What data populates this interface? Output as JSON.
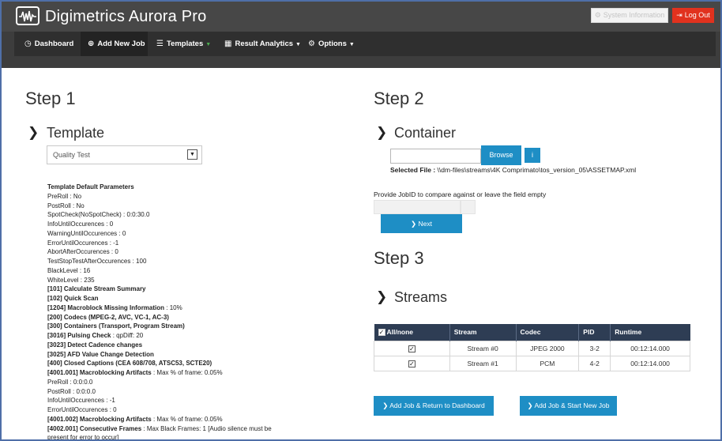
{
  "app": {
    "brand": "Digimetrics Aurora Pro",
    "system_info_label": "System Information",
    "logout_label": "Log Out"
  },
  "nav": {
    "dashboard": "Dashboard",
    "add_new_job": "Add New Job",
    "templates": "Templates",
    "result_analytics": "Result Analytics",
    "options": "Options"
  },
  "step1": {
    "title": "Step 1",
    "section": "Template",
    "selected_template": "Quality Test",
    "params_title": "Template Default Parameters",
    "params": [
      {
        "bold": "",
        "text": "PreRoll : No"
      },
      {
        "bold": "",
        "text": "PostRoll : No"
      },
      {
        "bold": "",
        "text": "SpotCheck(NoSpotCheck) : 0:0:30.0"
      },
      {
        "bold": "",
        "text": "InfoUntilOccurences : 0"
      },
      {
        "bold": "",
        "text": "WarningUntilOccurences : 0"
      },
      {
        "bold": "",
        "text": "ErrorUntilOccurences : -1"
      },
      {
        "bold": "",
        "text": "AbortAfterOccurences : 0"
      },
      {
        "bold": "",
        "text": "TestStopTestAfterOccurences : 100"
      },
      {
        "bold": "",
        "text": "BlackLevel : 16"
      },
      {
        "bold": "",
        "text": "WhiteLevel : 235"
      },
      {
        "bold": "[101] Calculate Stream Summary",
        "text": ""
      },
      {
        "bold": "[102] Quick Scan",
        "text": ""
      },
      {
        "bold": "[1204] Macroblock Missing Information",
        "text": " : 10%"
      },
      {
        "bold": "[200] Codecs (MPEG-2, AVC, VC-1, AC-3)",
        "text": ""
      },
      {
        "bold": "[300] Containers (Transport, Program Stream)",
        "text": ""
      },
      {
        "bold": "[3016] Pulsing Check",
        "text": " : qpDiff: 20"
      },
      {
        "bold": "[3023] Detect Cadence changes",
        "text": ""
      },
      {
        "bold": "[3025] AFD Value Change Detection",
        "text": ""
      },
      {
        "bold": "[400] Closed Captions (CEA 608/708, ATSC53, SCTE20)",
        "text": ""
      },
      {
        "bold": "[4001.001] Macroblocking Artifacts",
        "text": " : Max % of frame: 0.05%"
      },
      {
        "bold": "",
        "text": "PreRoll : 0:0:0.0"
      },
      {
        "bold": "",
        "text": "PostRoll : 0:0:0.0"
      },
      {
        "bold": "",
        "text": "InfoUntilOccurences : -1"
      },
      {
        "bold": "",
        "text": "ErrorUntilOccurences : 0"
      },
      {
        "bold": "[4001.002] Macroblocking Artifacts",
        "text": " : Max % of frame: 0.05%"
      },
      {
        "bold": "[4002.001] Consecutive Frames",
        "text": " : Max Black Frames: 1 [Audio silence must be"
      },
      {
        "bold": "",
        "text": "present for error to occur]"
      }
    ]
  },
  "step2": {
    "title": "Step 2",
    "section": "Container",
    "browse_label": "Browse",
    "info_icon": "info-icon",
    "selected_file_label": "Selected File :",
    "selected_file_path": " \\\\dm-files\\streams\\4K Comprimato\\tos_version_05\\ASSETMAP.xml",
    "jobid_prompt": "Provide JobID to compare against or leave the field empty",
    "jobid_value": "",
    "next_label": "Next"
  },
  "step3": {
    "title": "Step 3",
    "section": "Streams",
    "columns": [
      "All/none",
      "Stream",
      "Codec",
      "PID",
      "Runtime"
    ],
    "rows": [
      {
        "checked": true,
        "stream": "Stream #0",
        "codec": "JPEG 2000",
        "pid": "3-2",
        "runtime": "00:12:14.000"
      },
      {
        "checked": true,
        "stream": "Stream #1",
        "codec": "PCM",
        "pid": "4-2",
        "runtime": "00:12:14.000"
      }
    ]
  },
  "actions": {
    "add_return": "Add Job & Return to Dashboard",
    "add_new": "Add Job & Start New Job"
  },
  "colors": {
    "accent": "#1e8ec5",
    "logout": "#e1321e",
    "topbar": "#474747",
    "navbar": "#2f2f2f",
    "table_header": "#2e3d54"
  }
}
